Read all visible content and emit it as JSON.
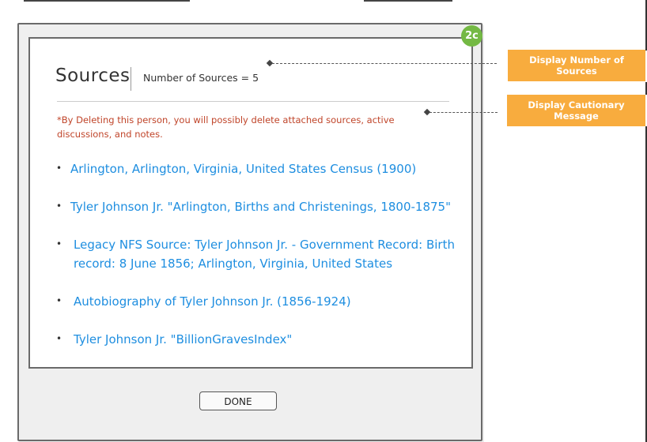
{
  "dialog": {
    "title": "Sources",
    "count_label": "Number of Sources = 5",
    "warning": "*By Deleting this person, you will possibly delete attached sources, active discussions, and notes.",
    "sources": [
      "Arlington,  Arlington, Virginia, United States Census (1900)",
      "Tyler Johnson Jr. \"Arlington, Births and Christenings, 1800-1875\"",
      "Legacy NFS Source: Tyler Johnson Jr. - Government Record: Birth record: 8 June 1856; Arlington, Virginia, United States",
      "Autobiography of Tyler Johnson Jr. (1856-1924)",
      "Tyler Johnson Jr. \"BillionGravesIndex\""
    ],
    "done_label": "DONE"
  },
  "badge": "2c",
  "annotations": {
    "number_of_sources": "Display Number of Sources",
    "cautionary_message": "Display Cautionary Message"
  },
  "colors": {
    "link": "#1e8ee0",
    "warning": "#c0452a",
    "annotation": "#f8ac3e",
    "badge": "#74b944"
  }
}
